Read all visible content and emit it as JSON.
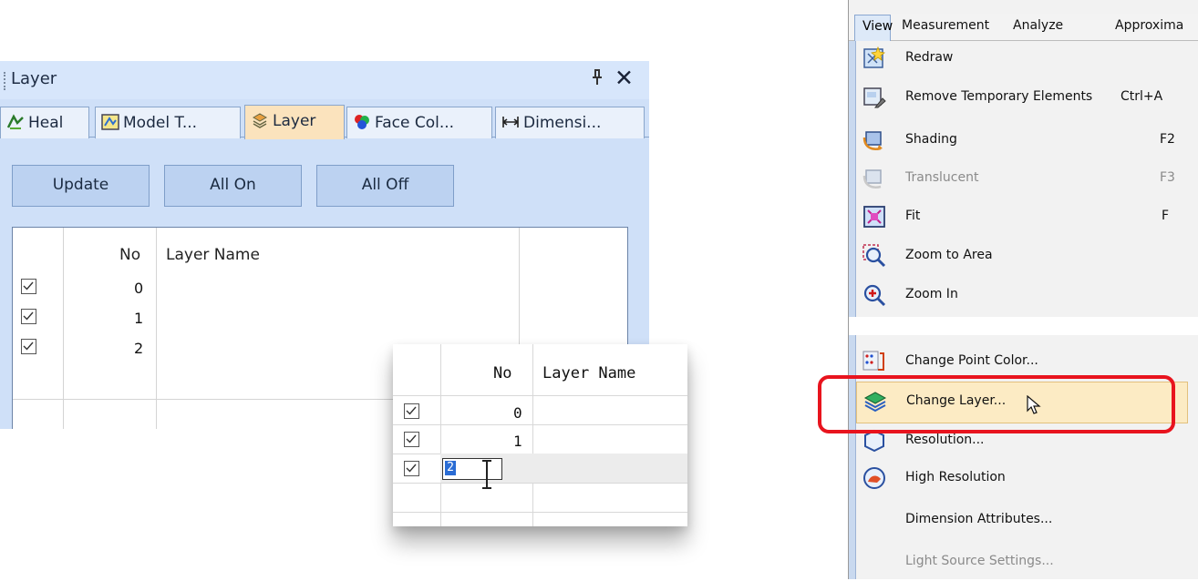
{
  "layer_panel": {
    "title": "Layer",
    "tabs": [
      {
        "label": "Heal",
        "icon": "heal-icon"
      },
      {
        "label": "Model T...",
        "icon": "model-tree-icon"
      },
      {
        "label": "Layer",
        "icon": "layer-icon"
      },
      {
        "label": "Face Col...",
        "icon": "face-color-icon"
      },
      {
        "label": "Dimensi...",
        "icon": "dimension-icon"
      }
    ],
    "active_tab": "Layer",
    "buttons": {
      "update": "Update",
      "all_on": "All On",
      "all_off": "All Off"
    },
    "columns": {
      "no": "No",
      "layer_name": "Layer Name"
    },
    "rows": [
      {
        "checked": true,
        "no": "0",
        "name": ""
      },
      {
        "checked": true,
        "no": "1",
        "name": ""
      },
      {
        "checked": true,
        "no": "2",
        "name": ""
      }
    ]
  },
  "zoom_popup": {
    "columns": {
      "no": "No",
      "layer_name": "Layer Name"
    },
    "rows": [
      {
        "checked": true,
        "no": "0"
      },
      {
        "checked": true,
        "no": "1"
      },
      {
        "checked": true,
        "no": "2",
        "editing": true,
        "edit_value": "2"
      }
    ]
  },
  "view_menu": {
    "menubar": [
      "View",
      "Measurement",
      "Analyze",
      "Approxima"
    ],
    "items": [
      {
        "label": "Redraw",
        "shortcut": "",
        "icon": "redraw-icon",
        "enabled": true
      },
      {
        "label": "Remove Temporary Elements",
        "shortcut": "Ctrl+A",
        "icon": "remove-temp-icon",
        "enabled": true
      },
      {
        "label": "Shading",
        "shortcut": "F2",
        "icon": "shading-icon",
        "enabled": true
      },
      {
        "label": "Translucent",
        "shortcut": "F3",
        "icon": "translucent-icon",
        "enabled": false
      },
      {
        "label": "Fit",
        "shortcut": "F",
        "icon": "fit-icon",
        "enabled": true
      },
      {
        "label": "Zoom to Area",
        "shortcut": "",
        "icon": "zoom-area-icon",
        "enabled": true
      },
      {
        "label": "Zoom In",
        "shortcut": "",
        "icon": "zoom-in-icon",
        "enabled": true
      },
      {
        "label": "Change Point Color...",
        "shortcut": "",
        "icon": "point-color-icon",
        "enabled": true
      },
      {
        "label": "Change Layer...",
        "shortcut": "",
        "icon": "change-layer-icon",
        "enabled": true,
        "highlighted": true
      },
      {
        "label": "Resolution...",
        "shortcut": "",
        "icon": "resolution-icon",
        "enabled": true
      },
      {
        "label": "High Resolution",
        "shortcut": "",
        "icon": "high-resolution-icon",
        "enabled": true
      },
      {
        "label": "Dimension Attributes...",
        "shortcut": "",
        "icon": "",
        "enabled": true
      },
      {
        "label": "Light Source Settings...",
        "shortcut": "",
        "icon": "",
        "enabled": false
      }
    ],
    "colors": {
      "highlight": "#fcebc4",
      "callout": "#e8141e"
    }
  }
}
